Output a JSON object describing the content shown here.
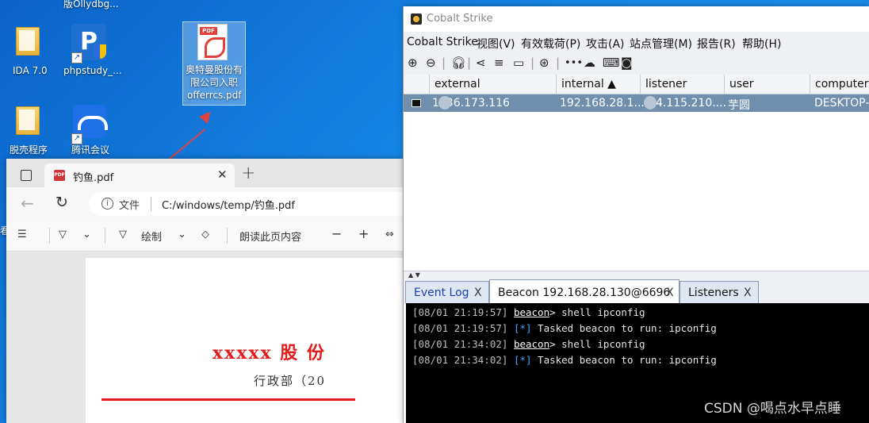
{
  "desktop": {
    "top_label": "版Ollydbg...",
    "icons": [
      {
        "label": "IDA 7.0"
      },
      {
        "label": "phpstudy_..."
      },
      {
        "label": "脱壳程序"
      },
      {
        "label": "腾讯会议"
      }
    ],
    "selected_file": {
      "line1": "奥特曼股份有",
      "line2": "限公司入职",
      "line3": "offerrcs.pdf"
    },
    "left_edge_text": "看"
  },
  "edge": {
    "tab_title": "钓鱼.pdf",
    "address_label": "文件",
    "address_url": "C:/windows/temp/钓鱼.pdf",
    "toolbar": {
      "draw_label": "绘制",
      "read_aloud": "朗读此页内容",
      "minus": "−",
      "plus": "+"
    },
    "document": {
      "title": "xxxxx 股 份",
      "subtitle": "行政部（20"
    }
  },
  "cobalt": {
    "window_title": "Cobalt Strike",
    "menu": [
      "Cobalt Strike",
      "视图(V)",
      "有效载荷(P)",
      "攻击(A)",
      "站点管理(M)",
      "报告(R)",
      "帮助(H)"
    ],
    "columns": [
      "external",
      "internal ▲",
      "listener",
      "user",
      "computer"
    ],
    "row": {
      "external": "1 .36.173.116",
      "internal": "192.168.28.1...",
      "listener": "4.115.210....",
      "user": "芋圆",
      "computer": "DESKTOP-"
    },
    "tabs": [
      {
        "label": "Event Log",
        "close": "X"
      },
      {
        "label": "Beacon 192.168.28.130@6696",
        "close": "X"
      },
      {
        "label": "Listeners",
        "close": "X"
      }
    ],
    "console": [
      {
        "ts": "[08/01 21:19:57]",
        "kind": "beacon",
        "prefix": "beacon",
        "text": "> shell ipconfig"
      },
      {
        "ts": "[08/01 21:19:57]",
        "kind": "star",
        "prefix": "[*]",
        "text": " Tasked beacon to run: ipconfig"
      },
      {
        "ts": "[08/01 21:34:02]",
        "kind": "beacon",
        "prefix": "beacon",
        "text": "> shell ipconfig"
      },
      {
        "ts": "[08/01 21:34:02]",
        "kind": "star",
        "prefix": "[*]",
        "text": " Tasked beacon to run: ipconfig"
      }
    ]
  },
  "watermark": "CSDN @喝点水早点睡"
}
